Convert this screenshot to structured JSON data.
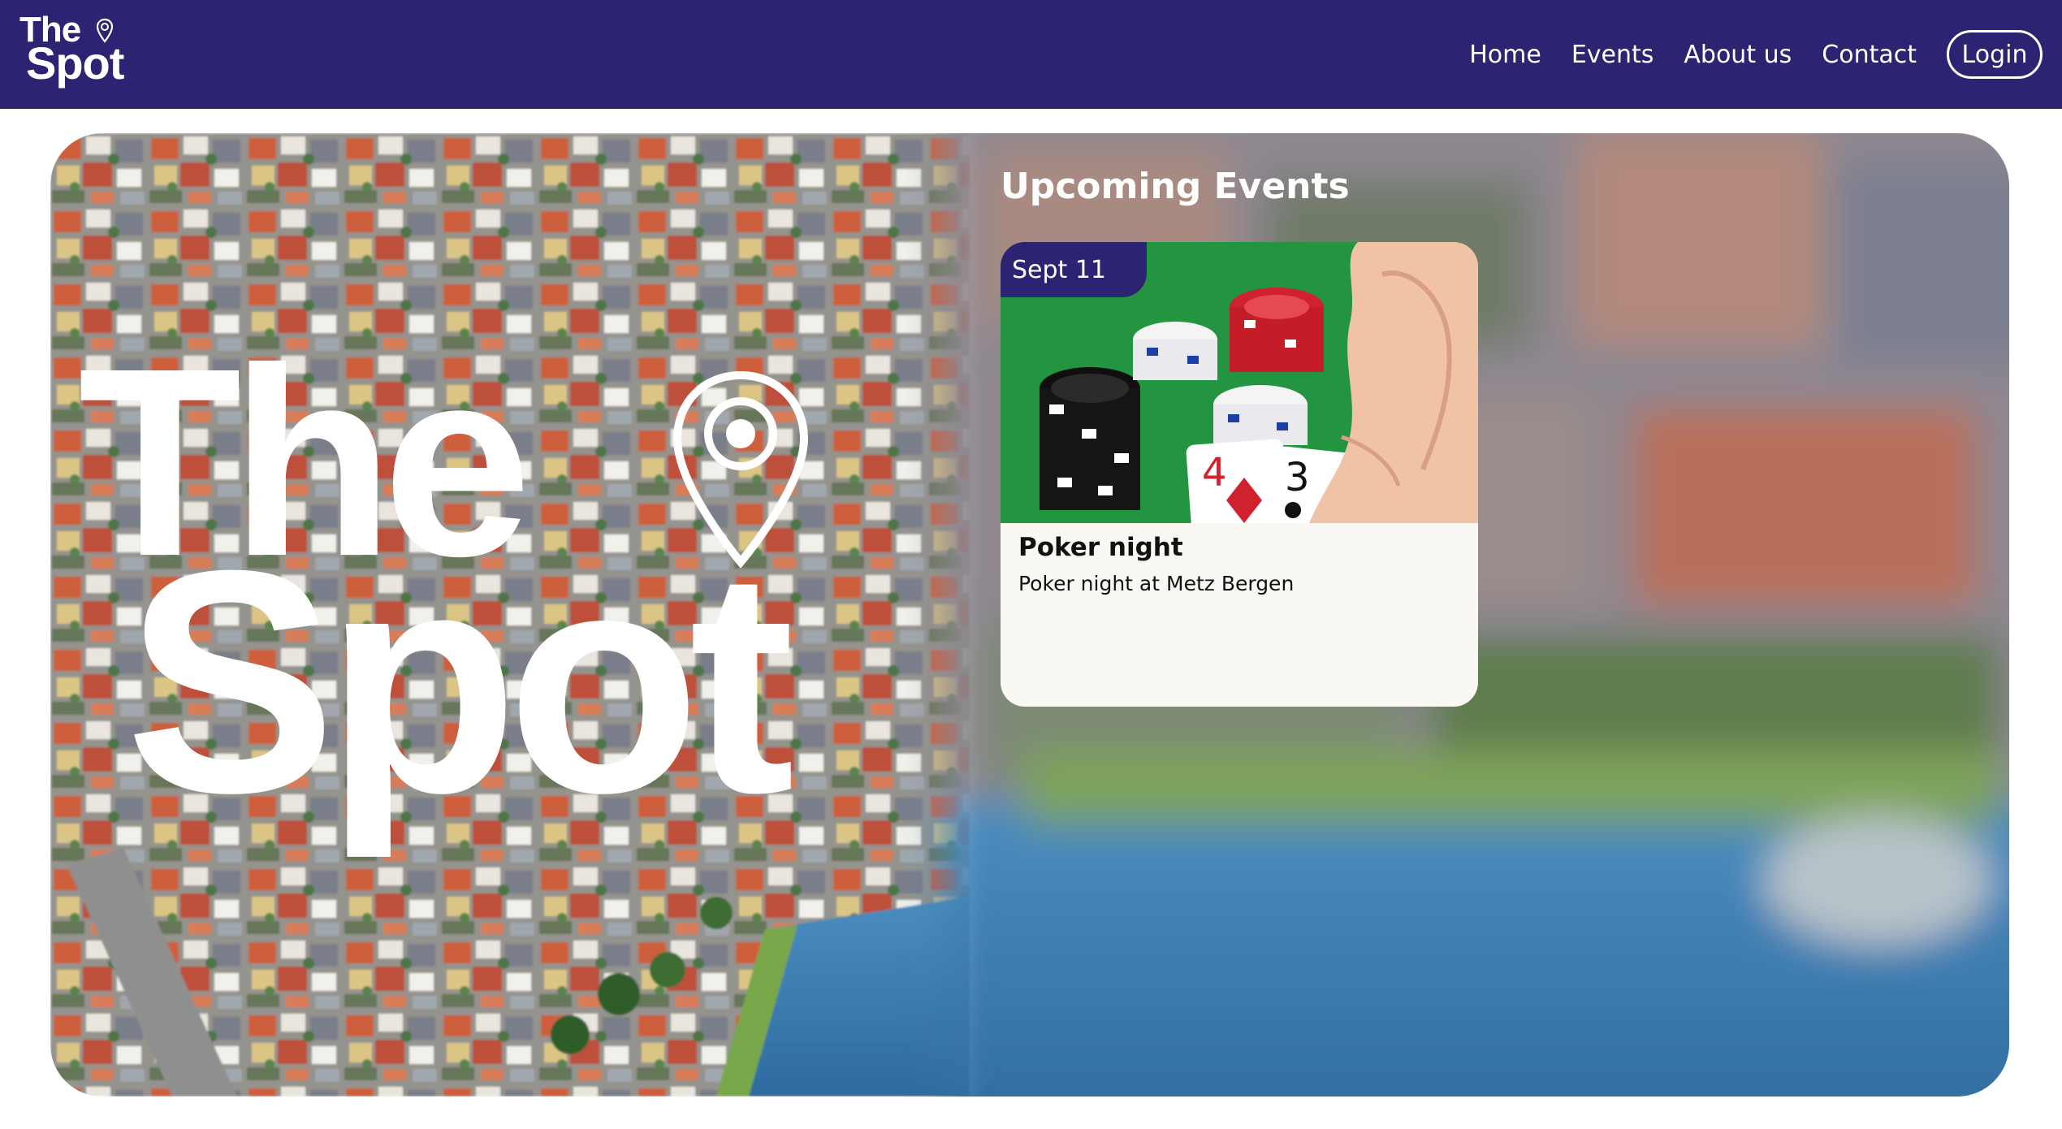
{
  "header": {
    "logo_line1": "The",
    "logo_line2": "Spot",
    "nav": {
      "home": "Home",
      "events": "Events",
      "about": "About us",
      "contact": "Contact"
    },
    "login_label": "Login"
  },
  "hero": {
    "logo_line1": "The",
    "logo_line2": "Spot",
    "icon": "location-pin-icon"
  },
  "events": {
    "title": "Upcoming Events",
    "items": [
      {
        "date": "Sept 11",
        "name": "Poker night",
        "description": "Poker night at Metz Bergen",
        "image": "poker-chips-and-cards"
      }
    ]
  },
  "colors": {
    "brand": "#2c2472",
    "card_background": "#faf8f2",
    "text_light": "#ffffff"
  }
}
